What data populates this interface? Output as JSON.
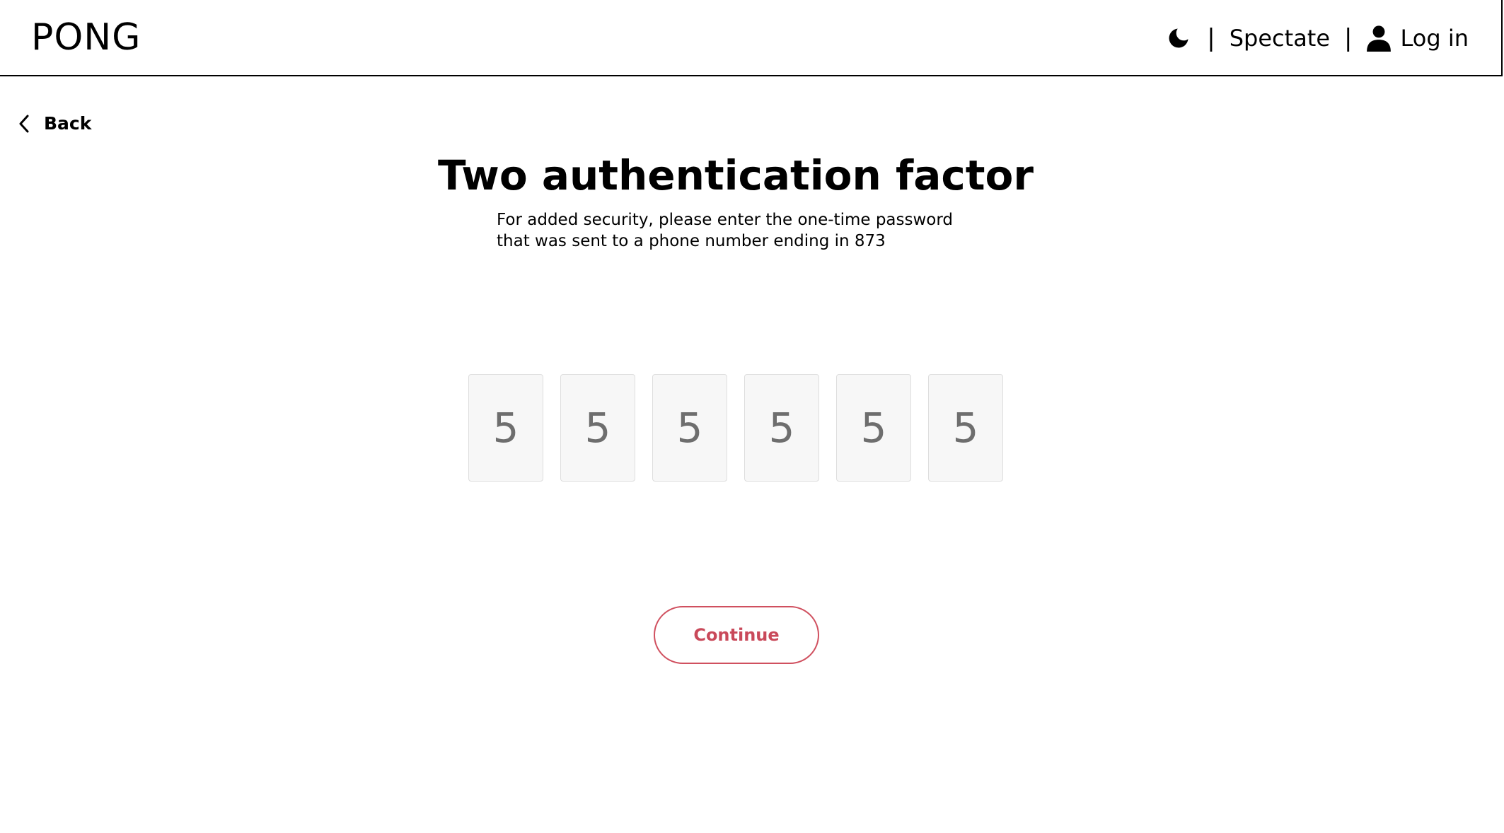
{
  "header": {
    "logo": "PONG",
    "separator": "|",
    "spectate_label": "Spectate",
    "login_label": "Log in",
    "theme_icon": "moon-icon",
    "login_icon": "user-icon"
  },
  "back": {
    "label": "Back",
    "icon": "chevron-left-icon"
  },
  "auth": {
    "title": "Two authentication factor",
    "subtitle_line1": "For added security, please enter the one-time password",
    "subtitle_line2": "that was sent to a phone number ending in 873",
    "otp_digits": [
      "5",
      "5",
      "5",
      "5",
      "5",
      "5"
    ],
    "continue_label": "Continue"
  },
  "colors": {
    "accent": "#c9495a",
    "text": "#000000",
    "otp_text": "#6e6e6e",
    "otp_bg": "#f7f7f7"
  }
}
